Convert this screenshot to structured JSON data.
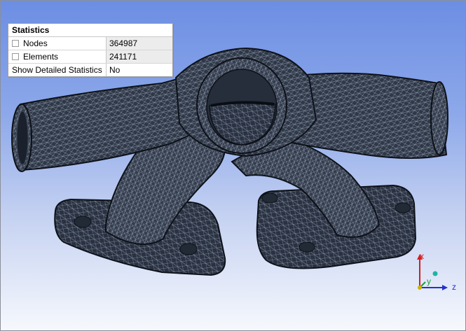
{
  "statistics": {
    "title": "Statistics",
    "rows": [
      {
        "label": "Nodes",
        "value": "364987",
        "has_checkbox": true
      },
      {
        "label": "Elements",
        "value": "241171",
        "has_checkbox": true
      },
      {
        "label": "Show Detailed Statistics",
        "value": "No",
        "has_checkbox": false
      }
    ]
  },
  "triad": {
    "x_label": "x",
    "y_label": "y",
    "z_label": "z",
    "x_color": "#d21f1f",
    "y_color": "#1e9e3a",
    "z_color": "#2233cc"
  },
  "colors": {
    "background_top": "#6c8ee3",
    "background_bottom": "#f6f8fd",
    "mesh_fill": "#2f3847",
    "mesh_lines": "#9aa5b8"
  }
}
